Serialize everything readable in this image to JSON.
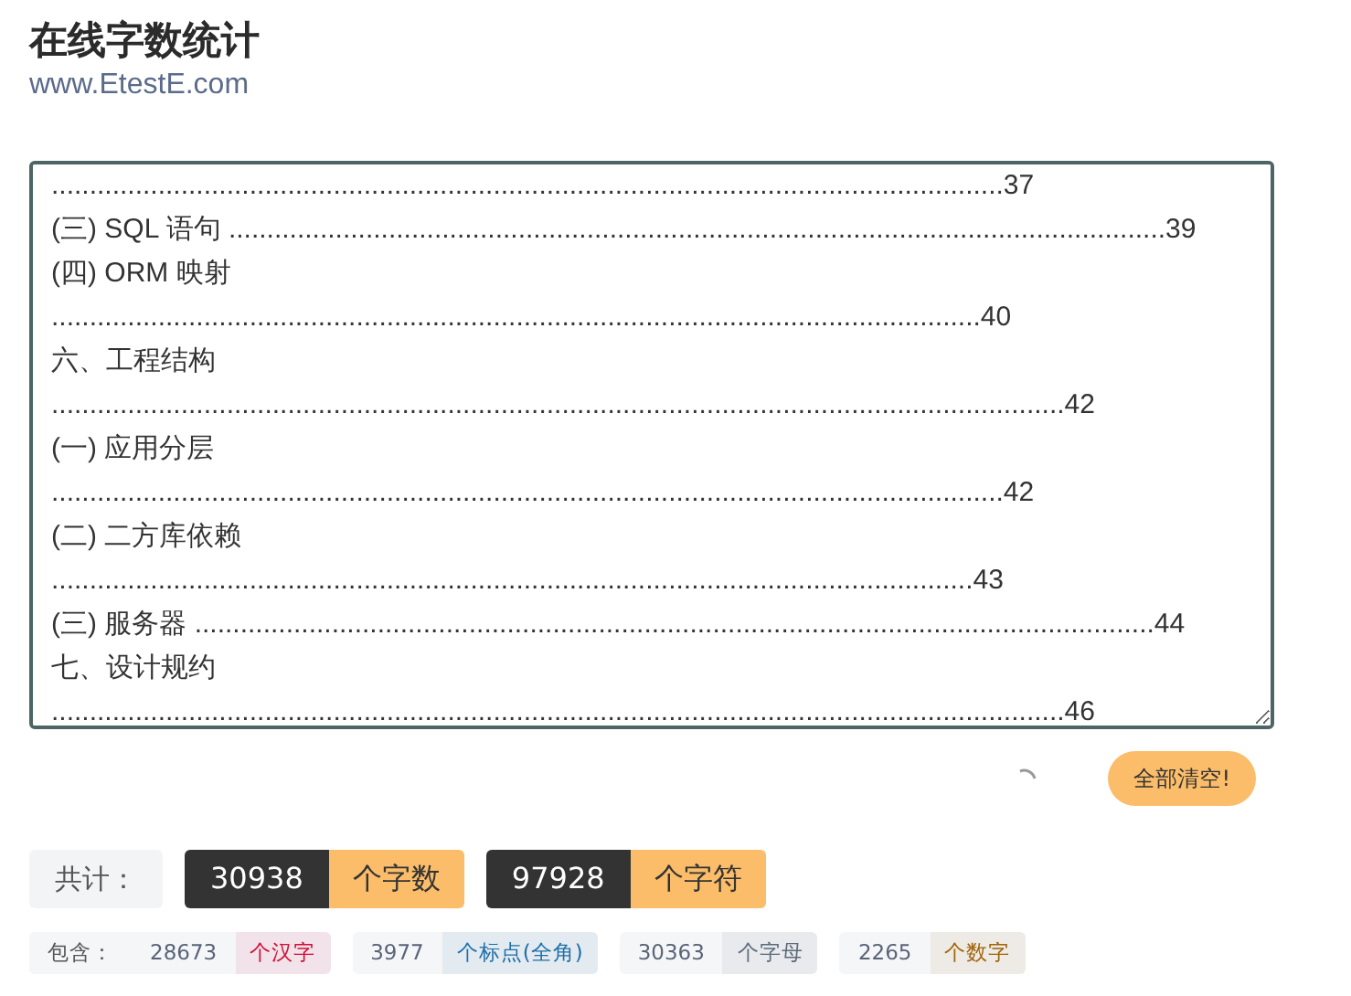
{
  "title": "在线字数统计",
  "site": "www.EtestE.com",
  "editor": {
    "lines": [
      ".............................................................................................................................37",
      "(三) SQL 语句 ...........................................................................................................................39",
      "(四) ORM 映射",
      "..........................................................................................................................40",
      "六、工程结构",
      ".....................................................................................................................................42",
      "(一) 应用分层",
      ".............................................................................................................................42",
      "(二) 二方库依赖",
      ".........................................................................................................................43",
      "(三) 服务器 ..............................................................................................................................44",
      "七、设计规约",
      ".....................................................................................................................................46"
    ]
  },
  "clear_button": "全部清空!",
  "totals": {
    "label": "共计：",
    "items": [
      {
        "value": "30938",
        "unit": "个字数"
      },
      {
        "value": "97928",
        "unit": "个字符"
      }
    ]
  },
  "breakdown": {
    "label": "包含：",
    "items": [
      {
        "value": "28673",
        "unit": "个汉字",
        "color": "#d0103a"
      },
      {
        "value": "3977",
        "unit": "个标点(全角)",
        "color": "#1f6fa8"
      },
      {
        "value": "30363",
        "unit": "个字母",
        "color": "#5c6b7a"
      },
      {
        "value": "2265",
        "unit": "个数字",
        "color": "#a0650a"
      }
    ]
  }
}
